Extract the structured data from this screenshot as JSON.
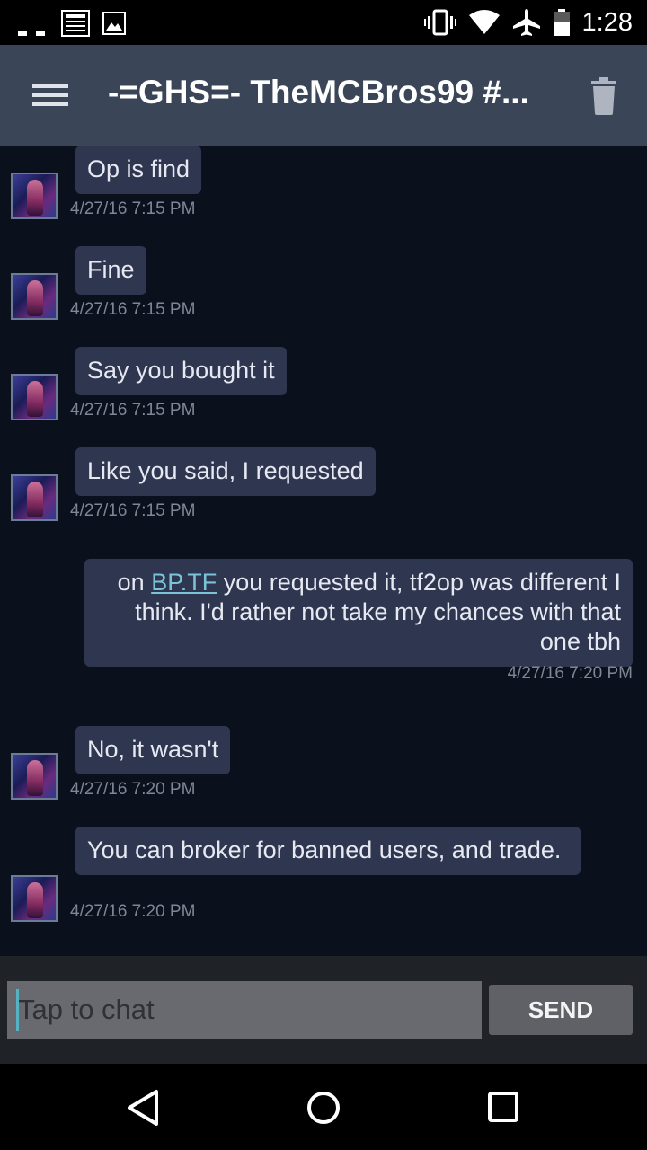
{
  "status_bar": {
    "time": "1:28",
    "icons": [
      "notification-icon",
      "news-icon",
      "image-icon",
      "vibrate-icon",
      "wifi-icon",
      "airplane-icon",
      "battery-icon"
    ]
  },
  "app_bar": {
    "title": "-=GHS=- TheMCBros99 #...",
    "menu_icon": "hamburger-menu-icon",
    "delete_icon": "trash-icon"
  },
  "messages": [
    {
      "direction": "in",
      "text": "Op is find",
      "timestamp": "4/27/16 7:15 PM"
    },
    {
      "direction": "in",
      "text": "Fine",
      "timestamp": "4/27/16 7:15 PM"
    },
    {
      "direction": "in",
      "text": "Say you bought it",
      "timestamp": "4/27/16 7:15 PM"
    },
    {
      "direction": "in",
      "text": "Like you said, I requested",
      "timestamp": "4/27/16 7:15 PM"
    },
    {
      "direction": "out",
      "text_before": "on ",
      "link": "BP.TF",
      "text_after": " you requested it, tf2op was different I think. I'd rather not take my chances with that one tbh",
      "timestamp": "4/27/16 7:20 PM"
    },
    {
      "direction": "in",
      "text": "No, it wasn't",
      "timestamp": "4/27/16 7:20 PM"
    },
    {
      "direction": "in",
      "text": "You can broker for banned users, and trade.",
      "timestamp": "4/27/16 7:20 PM"
    }
  ],
  "composer": {
    "placeholder": "Tap to chat",
    "send_label": "SEND"
  },
  "nav_bar": {
    "icons": [
      "back-icon",
      "home-icon",
      "recents-icon"
    ]
  },
  "colors": {
    "app_bar": "#3a4658",
    "background": "#0b111c",
    "bubble": "#2e3650",
    "link": "#7ac4d8",
    "timestamp": "#7f8796"
  }
}
